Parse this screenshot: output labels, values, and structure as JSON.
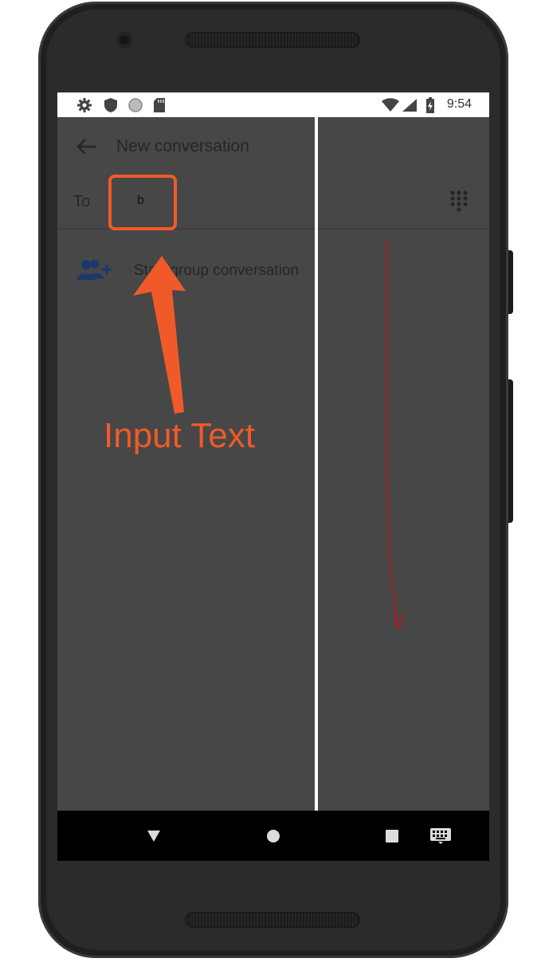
{
  "status_bar": {
    "time": "9:54",
    "icons": [
      "gear-icon",
      "shield-icon",
      "circle-icon",
      "sd-card-icon",
      "wifi-icon",
      "signal-icon",
      "battery-charging-icon"
    ]
  },
  "toolbar": {
    "title": "New conversation",
    "back_icon": "arrow-back-icon"
  },
  "recipient": {
    "label": "To",
    "value": "b",
    "dialpad_icon": "dialpad-icon"
  },
  "group_conversation": {
    "label": "Start group conversation",
    "icon": "group-add-icon"
  },
  "navigation_bar": {
    "icons": [
      "back-triangle-icon",
      "home-circle-icon",
      "recents-square-icon",
      "keyboard-icon"
    ]
  },
  "annotation": {
    "text": "Input Text",
    "color": "#f05a28"
  },
  "colors": {
    "screen_dim": "#474747",
    "accent_blue": "#1a3a6e",
    "trace_red": "#b51818"
  }
}
